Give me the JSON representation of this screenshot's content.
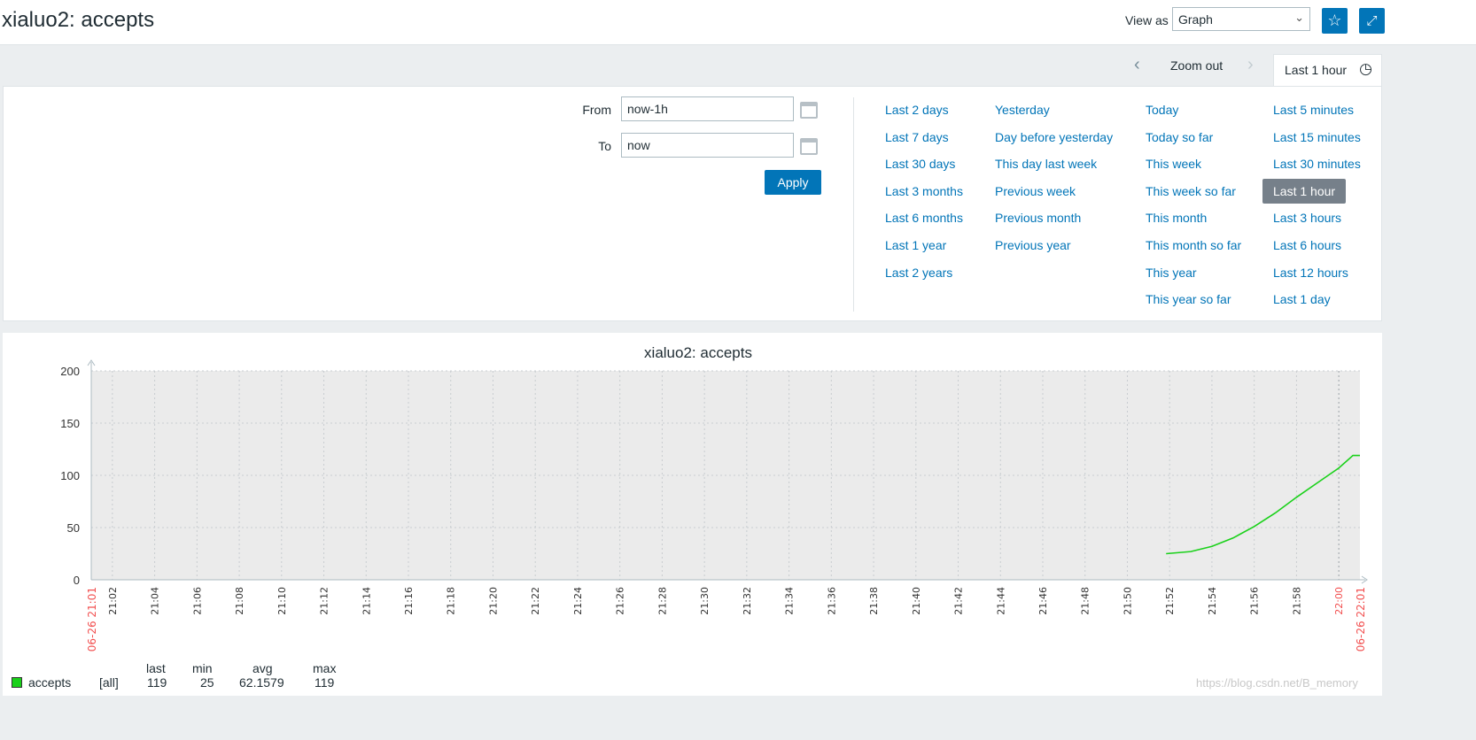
{
  "header": {
    "title": "xialuo2: accepts",
    "view_as_label": "View as",
    "view_as_value": "Graph",
    "favorite_icon": "star-icon",
    "fullscreen_icon": "expand-icon"
  },
  "timebar": {
    "prev_icon": "chevron-left-icon",
    "zoom_out": "Zoom out",
    "next_icon": "chevron-right-icon",
    "tab_label": "Last 1 hour",
    "clock_icon": "clock-icon"
  },
  "filter": {
    "from_label": "From",
    "from_value": "now-1h",
    "to_label": "To",
    "to_value": "now",
    "apply": "Apply",
    "columns": [
      [
        "Last 2 days",
        "Last 7 days",
        "Last 30 days",
        "Last 3 months",
        "Last 6 months",
        "Last 1 year",
        "Last 2 years"
      ],
      [
        "Yesterday",
        "Day before yesterday",
        "This day last week",
        "Previous week",
        "Previous month",
        "Previous year"
      ],
      [
        "Today",
        "Today so far",
        "This week",
        "This week so far",
        "This month",
        "This month so far",
        "This year",
        "This year so far"
      ],
      [
        "Last 5 minutes",
        "Last 15 minutes",
        "Last 30 minutes",
        "Last 1 hour",
        "Last 3 hours",
        "Last 6 hours",
        "Last 12 hours",
        "Last 1 day"
      ]
    ],
    "selected": "Last 1 hour"
  },
  "chart_data": {
    "type": "line",
    "title": "xialuo2: accepts",
    "ylim": [
      0,
      200
    ],
    "yticks": [
      0,
      50,
      100,
      150,
      200
    ],
    "xlim": [
      "06-26 21:01",
      "06-26 22:01"
    ],
    "xticks": [
      "21:02",
      "21:04",
      "21:06",
      "21:08",
      "21:10",
      "21:12",
      "21:14",
      "21:16",
      "21:18",
      "21:20",
      "21:22",
      "21:24",
      "21:26",
      "21:28",
      "21:30",
      "21:32",
      "21:34",
      "21:36",
      "21:38",
      "21:40",
      "21:42",
      "21:44",
      "21:46",
      "21:48",
      "21:50",
      "21:52",
      "21:54",
      "21:56",
      "21:58",
      "22:00"
    ],
    "highlight_tick": "22:00",
    "start_label": "06-26 21:01",
    "end_label": "06-26 22:01",
    "grid": true,
    "series": [
      {
        "name": "accepts",
        "color": "#1ad11a",
        "points": [
          [
            "21:51:50",
            25
          ],
          [
            "21:53:00",
            27
          ],
          [
            "21:54:00",
            32
          ],
          [
            "21:55:00",
            40
          ],
          [
            "21:56:00",
            51
          ],
          [
            "21:57:00",
            64
          ],
          [
            "21:58:00",
            79
          ],
          [
            "21:59:00",
            93
          ],
          [
            "22:00:00",
            107
          ],
          [
            "22:00:40",
            119
          ],
          [
            "22:01:00",
            119
          ]
        ]
      }
    ],
    "legend": {
      "headers": [
        "last",
        "min",
        "avg",
        "max"
      ],
      "name": "accepts",
      "func": "[all]",
      "last": "119",
      "min": "25",
      "avg": "62.1579",
      "max": "119"
    }
  },
  "watermark": "https://blog.csdn.net/B_memory"
}
